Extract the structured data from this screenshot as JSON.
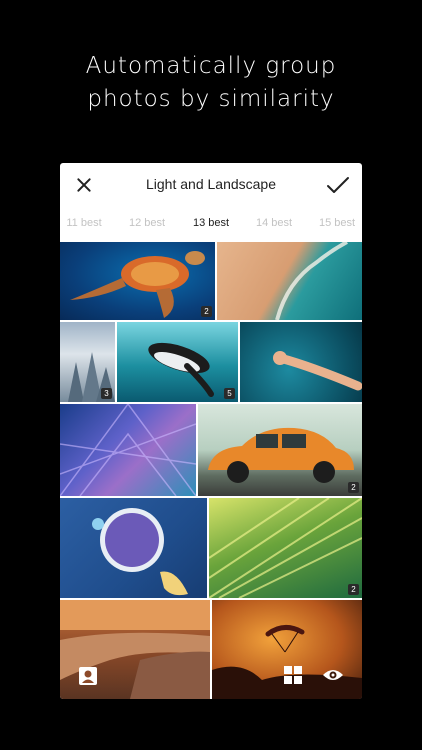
{
  "headline": {
    "line1": "Automatically group",
    "line2": "photos by similarity"
  },
  "card": {
    "title": "Light and Landscape",
    "icons": {
      "close": "close-icon",
      "confirm": "checkmark-icon"
    },
    "tabs": [
      {
        "label": "11 best",
        "active": false
      },
      {
        "label": "12 best",
        "active": false
      },
      {
        "label": "13 best",
        "active": true
      },
      {
        "label": "14 best",
        "active": false
      },
      {
        "label": "15 best",
        "active": false
      }
    ]
  },
  "photos": [
    {
      "name": "turtle-photo",
      "badge": "2"
    },
    {
      "name": "beach-aerial-photo",
      "badge": ""
    },
    {
      "name": "snowy-forest-photo",
      "badge": "3"
    },
    {
      "name": "penguin-photo",
      "badge": "5"
    },
    {
      "name": "hand-in-water-photo",
      "badge": ""
    },
    {
      "name": "geometric-ceiling-photo",
      "badge": ""
    },
    {
      "name": "orange-beetle-car-photo",
      "badge": "2"
    },
    {
      "name": "smoothie-bowl-photo",
      "badge": ""
    },
    {
      "name": "palm-leaf-photo",
      "badge": "2"
    },
    {
      "name": "coastline-sunset-photo",
      "badge": ""
    },
    {
      "name": "paraglider-sunset-photo",
      "badge": ""
    }
  ],
  "overlay_icons": [
    "portrait-icon",
    "grid-icon",
    "eye-icon"
  ],
  "colors": {
    "background": "#000000",
    "card": "#ffffff",
    "active_tab": "#222222",
    "inactive_tab": "#c3c3c3"
  }
}
